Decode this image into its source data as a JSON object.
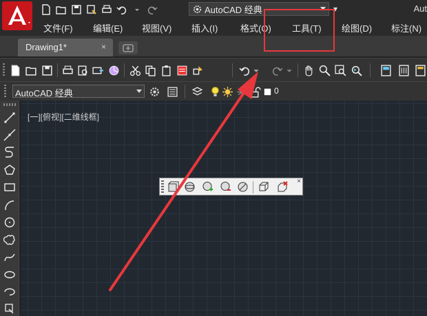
{
  "titlebar": {
    "workspace": "AutoCAD 经典",
    "app_title": "Aut"
  },
  "menu": {
    "items": [
      "文件(F)",
      "编辑(E)",
      "视图(V)",
      "插入(I)",
      "格式(O)",
      "工具(T)",
      "绘图(D)",
      "标注(N)"
    ]
  },
  "tabs": {
    "active_label": "Drawing1*",
    "close_glyph": "×"
  },
  "toolbar2": {
    "text_style": "AutoCAD 经典",
    "layer_value": "0"
  },
  "canvas": {
    "viewport_label": "[一][俯视][二维线框]"
  },
  "float_toolbar": {
    "close_glyph": "×"
  },
  "colors": {
    "background": "#2b2b2b",
    "canvas": "#212830",
    "annotation_red": "#e8383d",
    "logo_red": "#c8161d"
  },
  "icons": {
    "quick_access": [
      "new-icon",
      "open-icon",
      "save-icon",
      "save-as-icon",
      "plot-icon",
      "undo-icon",
      "redo-icon"
    ],
    "left_toolbar": [
      "line-icon",
      "construction-line-icon",
      "polyline-icon",
      "polygon-icon",
      "rectangle-icon",
      "arc-icon",
      "circle-icon",
      "revision-cloud-icon",
      "spline-icon",
      "ellipse-icon",
      "ellipse-arc-icon",
      "insert-block-icon"
    ]
  }
}
